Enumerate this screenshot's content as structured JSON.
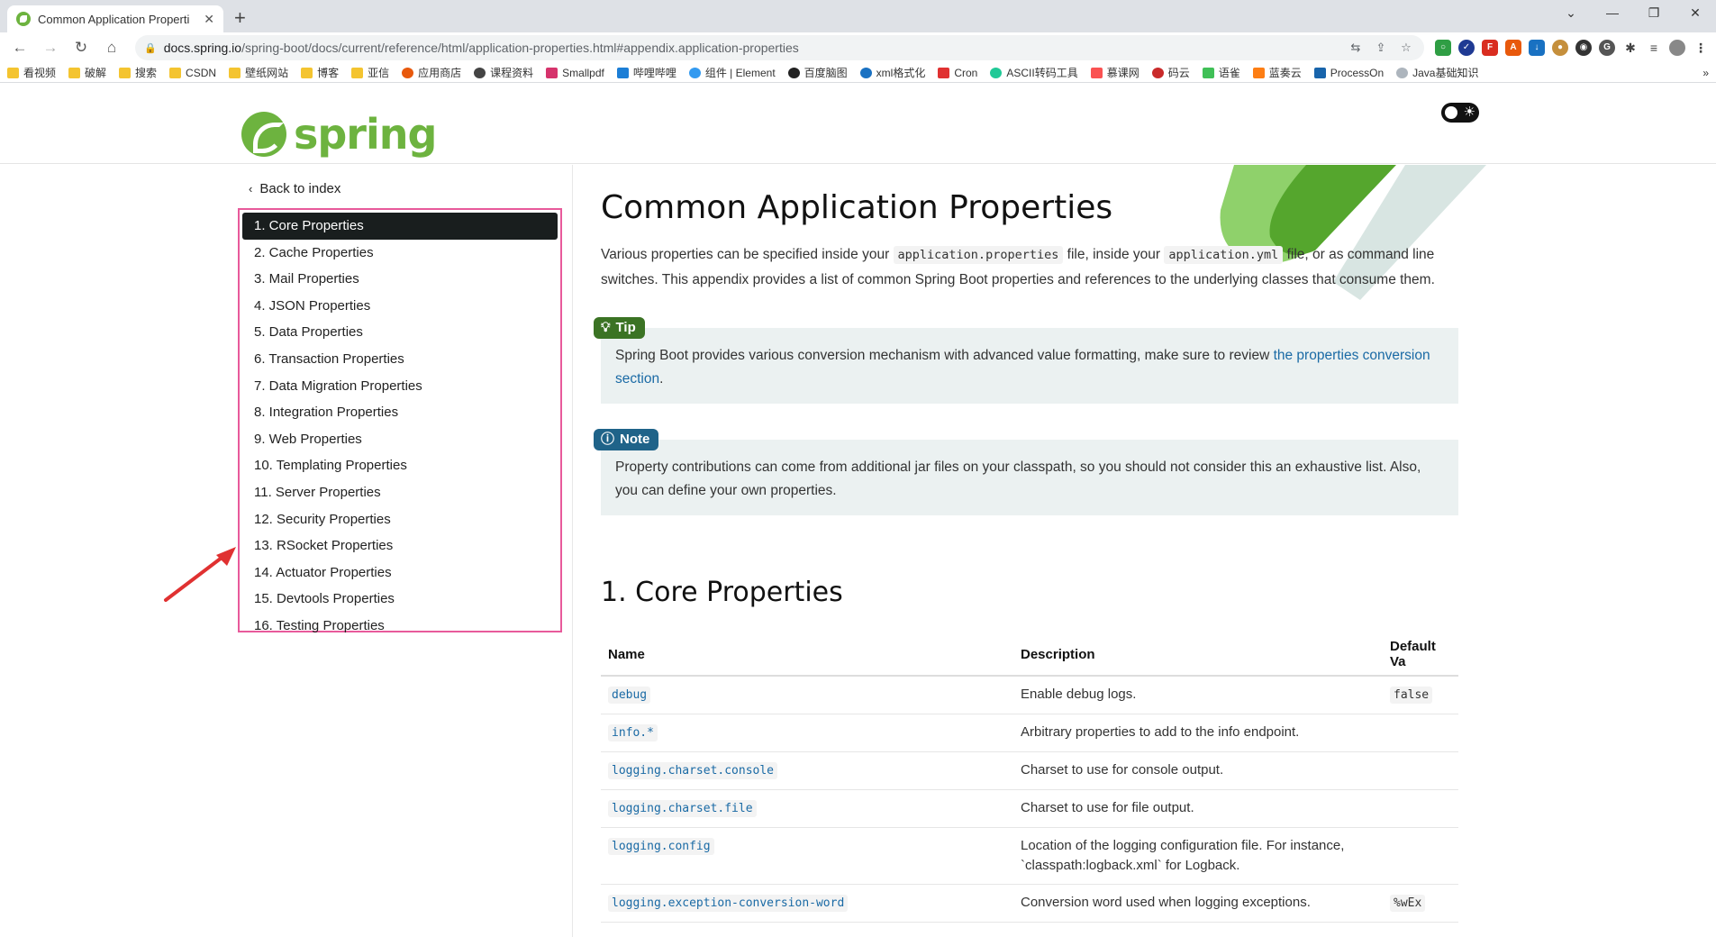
{
  "browser": {
    "tab_title": "Common Application Properti",
    "new_tab": "+",
    "url_host": "docs.spring.io",
    "url_path": "/spring-boot/docs/current/reference/html/application-properties.html#appendix.application-properties",
    "bookmarks": [
      "看视频",
      "破解",
      "搜索",
      "CSDN",
      "壁纸网站",
      "博客",
      "亚信",
      "应用商店",
      "课程资料",
      "Smallpdf",
      "哔哩哔哩",
      "组件 | Element",
      "百度脑图",
      "xml格式化",
      "Cron",
      "ASCII转码工具",
      "慕课网",
      "码云",
      "语雀",
      "蓝奏云",
      "ProcessOn",
      "Java基础知识"
    ],
    "bookmark_overflow": "»"
  },
  "header": {
    "logo_text": "spring"
  },
  "sidebar": {
    "back_label": "Back to index",
    "items": [
      "1. Core Properties",
      "2. Cache Properties",
      "3. Mail Properties",
      "4. JSON Properties",
      "5. Data Properties",
      "6. Transaction Properties",
      "7. Data Migration Properties",
      "8. Integration Properties",
      "9. Web Properties",
      "10. Templating Properties",
      "11. Server Properties",
      "12. Security Properties",
      "13. RSocket Properties",
      "14. Actuator Properties",
      "15. Devtools Properties",
      "16. Testing Properties"
    ]
  },
  "content": {
    "title": "Common Application Properties",
    "intro_1": "Various properties can be specified inside your ",
    "intro_code_1": "application.properties",
    "intro_2": " file, inside your ",
    "intro_code_2": "application.yml",
    "intro_3": " file, or as command line switches. This appendix provides a list of common Spring Boot properties and references to the underlying classes that consume them.",
    "tip_label": "Tip",
    "tip_text": "Spring Boot provides various conversion mechanism with advanced value formatting, make sure to review ",
    "tip_link": "the properties conversion section",
    "tip_end": ".",
    "note_label": "Note",
    "note_text": "Property contributions can come from additional jar files on your classpath, so you should not consider this an exhaustive list. Also, you can define your own properties.",
    "section_title": "1. Core Properties",
    "table": {
      "headers": [
        "Name",
        "Description",
        "Default Va"
      ],
      "rows": [
        {
          "name": "debug",
          "desc": "Enable debug logs.",
          "default": "false"
        },
        {
          "name": "info.*",
          "desc": "Arbitrary properties to add to the info endpoint.",
          "default": ""
        },
        {
          "name": "logging.charset.console",
          "desc": "Charset to use for console output.",
          "default": ""
        },
        {
          "name": "logging.charset.file",
          "desc": "Charset to use for file output.",
          "default": ""
        },
        {
          "name": "logging.config",
          "desc": "Location of the logging configuration file. For instance, `classpath:logback.xml` for Logback.",
          "default": ""
        },
        {
          "name": "logging.exception-conversion-word",
          "desc": "Conversion word used when logging exceptions.",
          "default": "%wEx"
        }
      ]
    }
  },
  "colors": {
    "spring_green": "#6db33f",
    "active_toc": "#191e1e",
    "highlight_border": "#e85a9b",
    "tip": "#3b7324",
    "note": "#1f6389"
  }
}
